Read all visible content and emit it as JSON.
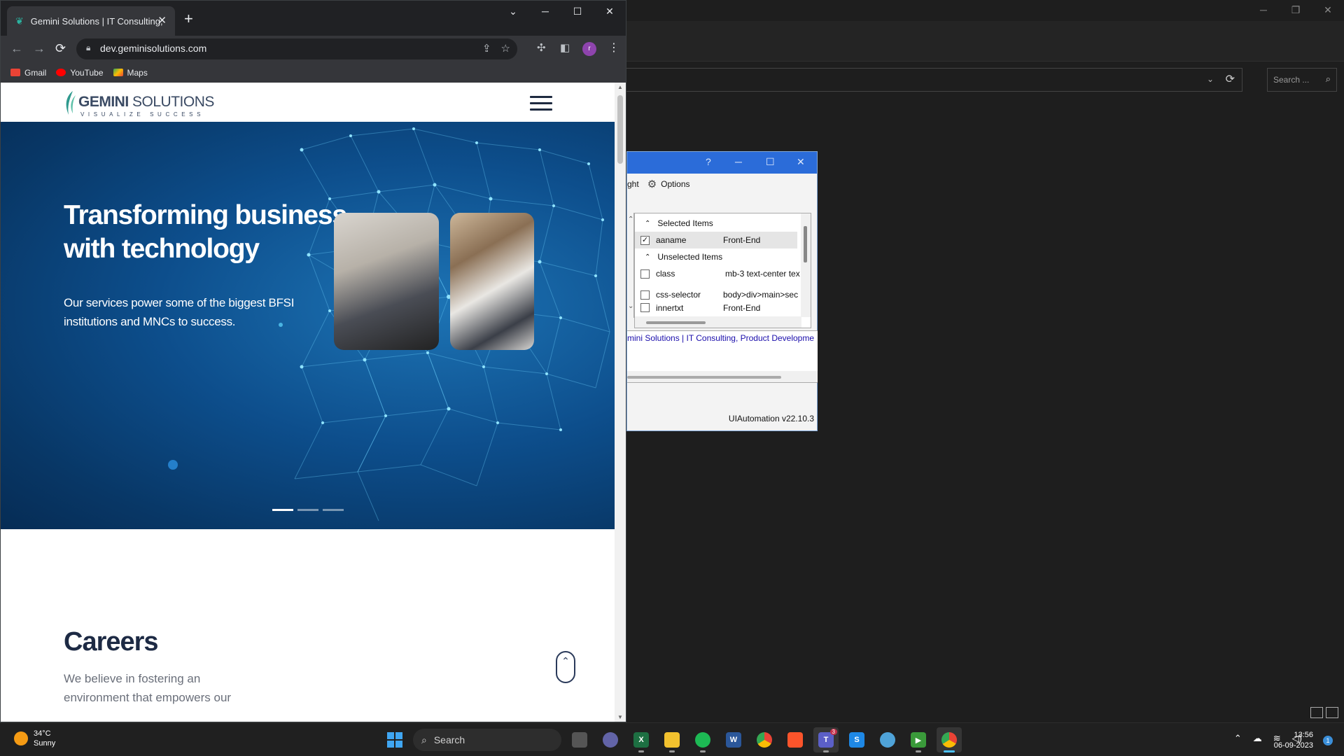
{
  "browser": {
    "tab_title": "Gemini Solutions | IT Consulting,",
    "url": "dev.geminisolutions.com",
    "profile_initial": "r",
    "bookmarks": [
      {
        "label": "Gmail",
        "color": "#ea4335"
      },
      {
        "label": "YouTube",
        "color": "#ff0000"
      },
      {
        "label": "Maps",
        "color": "#34a853"
      }
    ]
  },
  "site": {
    "logo_name_bold": "GEMINI",
    "logo_name_light": " SOLUTIONS",
    "logo_tagline": "VISUALIZE SUCCESS",
    "hero_title": "Transforming business with technology",
    "hero_subtitle": "Our services power some of the biggest BFSI institutions and MNCs to success.",
    "slides_count": 3,
    "active_slide": 1,
    "careers_title": "Careers",
    "careers_text": "We believe in fostering an environment that empowers our"
  },
  "inspector": {
    "help": "?",
    "toolbar_partial": "ght",
    "options_label": "Options",
    "selected_group": "Selected Items",
    "unselected_group": "Unselected Items",
    "rows": [
      {
        "name": "aaname",
        "value": "Front-End",
        "checked": true
      },
      {
        "name": "class",
        "value": "mb-3 text-center tex",
        "checked": false
      },
      {
        "name": "css-selector",
        "value": "body>div>main>sec",
        "checked": false
      },
      {
        "name": "innertxt",
        "value": "Front-End",
        "checked": false
      }
    ],
    "link_text": "mini Solutions | IT Consulting, Product Developme",
    "version": "UIAutomation v22.10.3"
  },
  "bgapp": {
    "search_placeholder": "Search ..."
  },
  "taskbar": {
    "temp": "34°C",
    "condition": "Sunny",
    "search_label": "Search",
    "time": "13:56",
    "date": "06-09-2023",
    "notifications": "1",
    "teams_badge": "3"
  }
}
